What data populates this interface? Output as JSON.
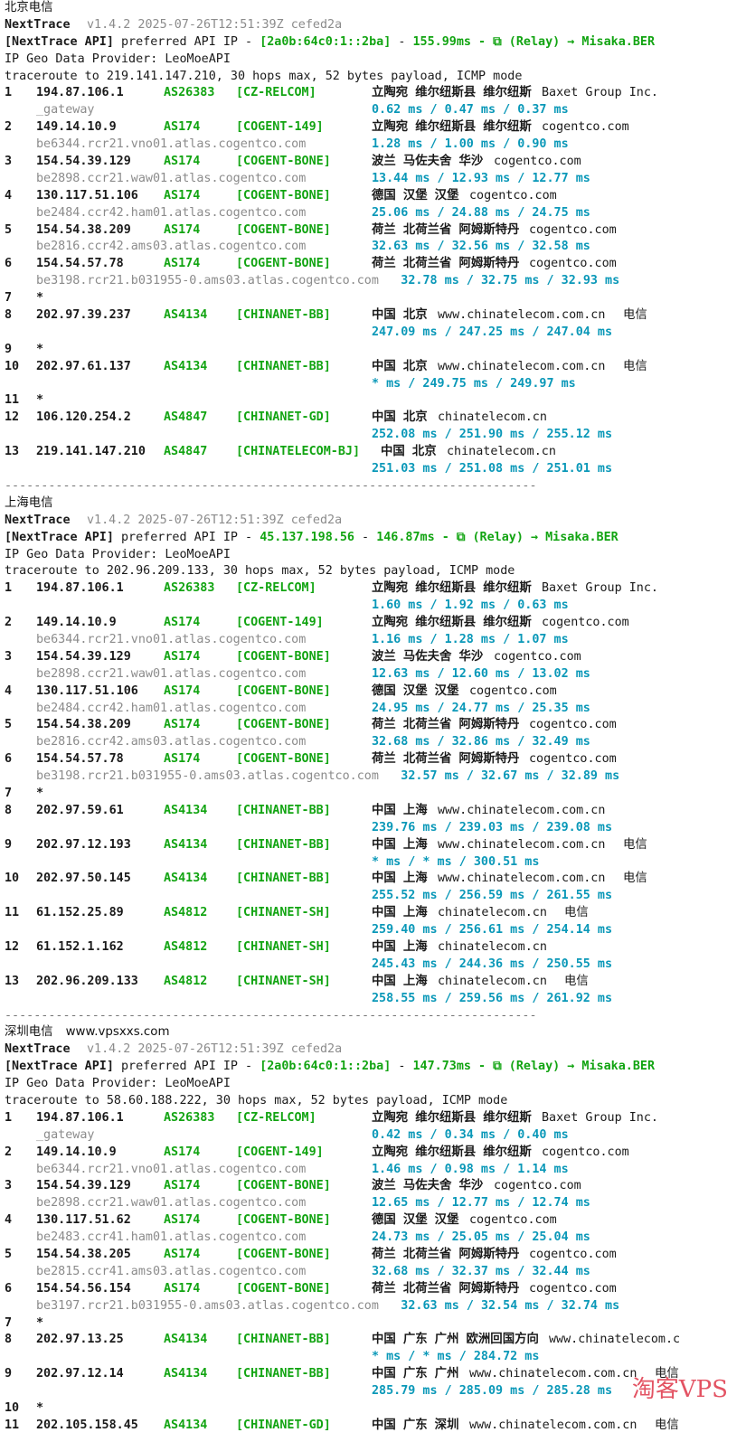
{
  "watermark": "淘客VPS",
  "sections": [
    {
      "name": "北京电信",
      "extra": "",
      "app": "NextTrace",
      "version": "v1.4.2 2025-07-26T12:51:39Z cefed2a",
      "api_prefix": "[NextTrace API]",
      "api_mid": " preferred API IP - ",
      "api_ip": "[2a0b:64c0:1::2ba]",
      "api_sep": " - ",
      "api_ms": "155.99ms",
      "api_tail": " - ⧉ (Relay) → Misaka.BER",
      "geo_provider": "IP Geo Data Provider: LeoMoeAPI",
      "traceroute": "traceroute to 219.141.147.210, 30 hops max, 52 bytes payload, ICMP mode",
      "hops": [
        {
          "n": "1",
          "ip": "194.87.106.1",
          "asn": "AS26383",
          "tag": "[CZ-RELCOM]",
          "geo": "立陶宛 维尔纽斯县 维尔纽斯",
          "dom": "Baxet Group Inc.",
          "rdns": "_gateway",
          "lat": "0.62 ms / 0.47 ms / 0.37 ms"
        },
        {
          "n": "2",
          "ip": "149.14.10.9",
          "asn": "AS174",
          "tag": "[COGENT-149]",
          "geo": "立陶宛 维尔纽斯县 维尔纽斯",
          "dom": "cogentco.com",
          "rdns": "be6344.rcr21.vno01.atlas.cogentco.com",
          "lat": "1.28 ms / 1.00 ms / 0.90 ms"
        },
        {
          "n": "3",
          "ip": "154.54.39.129",
          "asn": "AS174",
          "tag": "[COGENT-BONE]",
          "geo": "波兰 马佐夫舍 华沙",
          "dom": "cogentco.com",
          "rdns": "be2898.ccr21.waw01.atlas.cogentco.com",
          "lat": "13.44 ms / 12.93 ms / 12.77 ms"
        },
        {
          "n": "4",
          "ip": "130.117.51.106",
          "asn": "AS174",
          "tag": "[COGENT-BONE]",
          "geo": "德国 汉堡 汉堡",
          "dom": "cogentco.com",
          "rdns": "be2484.ccr42.ham01.atlas.cogentco.com",
          "lat": "25.06 ms / 24.88 ms / 24.75 ms"
        },
        {
          "n": "5",
          "ip": "154.54.38.209",
          "asn": "AS174",
          "tag": "[COGENT-BONE]",
          "geo": "荷兰 北荷兰省 阿姆斯特丹",
          "dom": "cogentco.com",
          "rdns": "be2816.ccr42.ams03.atlas.cogentco.com",
          "lat": "32.63 ms / 32.56 ms / 32.58 ms"
        },
        {
          "n": "6",
          "ip": "154.54.57.78",
          "asn": "AS174",
          "tag": "[COGENT-BONE]",
          "geo": "荷兰 北荷兰省 阿姆斯特丹",
          "dom": "cogentco.com",
          "rdns": "be3198.rcr21.b031955-0.ams03.atlas.cogentco.com",
          "lat": "32.78 ms / 32.75 ms / 32.93 ms",
          "inline": true
        },
        {
          "n": "7",
          "star": true
        },
        {
          "n": "8",
          "ip": "202.97.39.237",
          "asn": "AS4134",
          "tag": "[CHINANET-BB]",
          "geo": "中国 北京",
          "dom": "www.chinatelecom.com.cn",
          "isp": "电信",
          "lat": "247.09 ms / 247.25 ms / 247.04 ms"
        },
        {
          "n": "9",
          "star": true
        },
        {
          "n": "10",
          "ip": "202.97.61.137",
          "asn": "AS4134",
          "tag": "[CHINANET-BB]",
          "geo": "中国 北京",
          "dom": "www.chinatelecom.com.cn",
          "isp": "电信",
          "lat": "* ms / 249.75 ms / 249.97 ms"
        },
        {
          "n": "11",
          "star": true
        },
        {
          "n": "12",
          "ip": "106.120.254.2",
          "asn": "AS4847",
          "tag": "[CHINANET-GD]",
          "geo": "中国 北京",
          "dom": "chinatelecom.cn",
          "lat": "252.08 ms / 251.90 ms / 255.12 ms"
        },
        {
          "n": "13",
          "ip": "219.141.147.210",
          "asn": "AS4847",
          "tag": "[CHINATELECOM-BJ]",
          "geo": "中国 北京",
          "dom": "chinatelecom.cn",
          "lat": "251.03 ms / 251.08 ms / 251.01 ms",
          "geo_shift": true
        }
      ]
    },
    {
      "name": "上海电信",
      "extra": "",
      "app": "NextTrace",
      "version": "v1.4.2 2025-07-26T12:51:39Z cefed2a",
      "api_prefix": "[NextTrace API]",
      "api_mid": " preferred API IP - ",
      "api_ip": "45.137.198.56",
      "api_sep": " - ",
      "api_ms": "146.87ms",
      "api_tail": " - ⧉ (Relay) → Misaka.BER",
      "geo_provider": "IP Geo Data Provider: LeoMoeAPI",
      "traceroute": "traceroute to 202.96.209.133, 30 hops max, 52 bytes payload, ICMP mode",
      "hops": [
        {
          "n": "1",
          "ip": "194.87.106.1",
          "asn": "AS26383",
          "tag": "[CZ-RELCOM]",
          "geo": "立陶宛 维尔纽斯县 维尔纽斯",
          "dom": "Baxet Group Inc.",
          "rdns": "",
          "lat": "1.60 ms / 1.92 ms / 0.63 ms"
        },
        {
          "n": "2",
          "ip": "149.14.10.9",
          "asn": "AS174",
          "tag": "[COGENT-149]",
          "geo": "立陶宛 维尔纽斯县 维尔纽斯",
          "dom": "cogentco.com",
          "rdns": "be6344.rcr21.vno01.atlas.cogentco.com",
          "lat": "1.16 ms / 1.28 ms / 1.07 ms"
        },
        {
          "n": "3",
          "ip": "154.54.39.129",
          "asn": "AS174",
          "tag": "[COGENT-BONE]",
          "geo": "波兰 马佐夫舍 华沙",
          "dom": "cogentco.com",
          "rdns": "be2898.ccr21.waw01.atlas.cogentco.com",
          "lat": "12.63 ms / 12.60 ms / 13.02 ms"
        },
        {
          "n": "4",
          "ip": "130.117.51.106",
          "asn": "AS174",
          "tag": "[COGENT-BONE]",
          "geo": "德国 汉堡 汉堡",
          "dom": "cogentco.com",
          "rdns": "be2484.ccr42.ham01.atlas.cogentco.com",
          "lat": "24.95 ms / 24.77 ms / 25.35 ms"
        },
        {
          "n": "5",
          "ip": "154.54.38.209",
          "asn": "AS174",
          "tag": "[COGENT-BONE]",
          "geo": "荷兰 北荷兰省 阿姆斯特丹",
          "dom": "cogentco.com",
          "rdns": "be2816.ccr42.ams03.atlas.cogentco.com",
          "lat": "32.68 ms / 32.86 ms / 32.49 ms"
        },
        {
          "n": "6",
          "ip": "154.54.57.78",
          "asn": "AS174",
          "tag": "[COGENT-BONE]",
          "geo": "荷兰 北荷兰省 阿姆斯特丹",
          "dom": "cogentco.com",
          "rdns": "be3198.rcr21.b031955-0.ams03.atlas.cogentco.com",
          "lat": "32.57 ms / 32.67 ms / 32.89 ms",
          "inline": true
        },
        {
          "n": "7",
          "star": true
        },
        {
          "n": "8",
          "ip": "202.97.59.61",
          "asn": "AS4134",
          "tag": "[CHINANET-BB]",
          "geo": "中国 上海",
          "dom": "www.chinatelecom.com.cn",
          "lat": "239.76 ms / 239.03 ms / 239.08 ms"
        },
        {
          "n": "9",
          "ip": "202.97.12.193",
          "asn": "AS4134",
          "tag": "[CHINANET-BB]",
          "geo": "中国 上海",
          "dom": "www.chinatelecom.com.cn",
          "isp": "电信",
          "lat": "* ms / * ms / 300.51 ms"
        },
        {
          "n": "10",
          "ip": "202.97.50.145",
          "asn": "AS4134",
          "tag": "[CHINANET-BB]",
          "geo": "中国 上海",
          "dom": "www.chinatelecom.com.cn",
          "isp": "电信",
          "lat": "255.52 ms / 256.59 ms / 261.55 ms"
        },
        {
          "n": "11",
          "ip": "61.152.25.89",
          "asn": "AS4812",
          "tag": "[CHINANET-SH]",
          "geo": "中国 上海",
          "dom": "chinatelecom.cn",
          "isp": "电信",
          "lat": "259.40 ms / 256.61 ms / 254.14 ms"
        },
        {
          "n": "12",
          "ip": "61.152.1.162",
          "asn": "AS4812",
          "tag": "[CHINANET-SH]",
          "geo": "中国 上海",
          "dom": "chinatelecom.cn",
          "lat": "245.43 ms / 244.36 ms / 250.55 ms"
        },
        {
          "n": "13",
          "ip": "202.96.209.133",
          "asn": "AS4812",
          "tag": "[CHINANET-SH]",
          "geo": "中国 上海",
          "dom": "chinatelecom.cn",
          "isp": "电信",
          "lat": "258.55 ms / 259.56 ms / 261.92 ms"
        }
      ]
    },
    {
      "name": "深圳电信",
      "extra": "www.vpsxxs.com",
      "app": "NextTrace",
      "version": "v1.4.2 2025-07-26T12:51:39Z cefed2a",
      "api_prefix": "[NextTrace API]",
      "api_mid": " preferred API IP - ",
      "api_ip": "[2a0b:64c0:1::2ba]",
      "api_sep": " - ",
      "api_ms": "147.73ms",
      "api_tail": " - ⧉ (Relay) → Misaka.BER",
      "geo_provider": "IP Geo Data Provider: LeoMoeAPI",
      "traceroute": "traceroute to 58.60.188.222, 30 hops max, 52 bytes payload, ICMP mode",
      "hops": [
        {
          "n": "1",
          "ip": "194.87.106.1",
          "asn": "AS26383",
          "tag": "[CZ-RELCOM]",
          "geo": "立陶宛 维尔纽斯县 维尔纽斯",
          "dom": "Baxet Group Inc.",
          "rdns": "_gateway",
          "lat": "0.42 ms / 0.34 ms / 0.40 ms"
        },
        {
          "n": "2",
          "ip": "149.14.10.9",
          "asn": "AS174",
          "tag": "[COGENT-149]",
          "geo": "立陶宛 维尔纽斯县 维尔纽斯",
          "dom": "cogentco.com",
          "rdns": "be6344.rcr21.vno01.atlas.cogentco.com",
          "lat": "1.46 ms / 0.98 ms / 1.14 ms"
        },
        {
          "n": "3",
          "ip": "154.54.39.129",
          "asn": "AS174",
          "tag": "[COGENT-BONE]",
          "geo": "波兰 马佐夫舍 华沙",
          "dom": "cogentco.com",
          "rdns": "be2898.ccr21.waw01.atlas.cogentco.com",
          "lat": "12.65 ms / 12.77 ms / 12.74 ms"
        },
        {
          "n": "4",
          "ip": "130.117.51.62",
          "asn": "AS174",
          "tag": "[COGENT-BONE]",
          "geo": "德国 汉堡 汉堡",
          "dom": "cogentco.com",
          "rdns": "be2483.ccr41.ham01.atlas.cogentco.com",
          "lat": "24.73 ms / 25.05 ms / 25.04 ms"
        },
        {
          "n": "5",
          "ip": "154.54.38.205",
          "asn": "AS174",
          "tag": "[COGENT-BONE]",
          "geo": "荷兰 北荷兰省 阿姆斯特丹",
          "dom": "cogentco.com",
          "rdns": "be2815.ccr41.ams03.atlas.cogentco.com",
          "lat": "32.68 ms / 32.37 ms / 32.44 ms"
        },
        {
          "n": "6",
          "ip": "154.54.56.154",
          "asn": "AS174",
          "tag": "[COGENT-BONE]",
          "geo": "荷兰 北荷兰省 阿姆斯特丹",
          "dom": "cogentco.com",
          "rdns": "be3197.rcr21.b031955-0.ams03.atlas.cogentco.com",
          "lat": "32.63 ms / 32.54 ms / 32.74 ms",
          "inline": true
        },
        {
          "n": "7",
          "star": true
        },
        {
          "n": "8",
          "ip": "202.97.13.25",
          "asn": "AS4134",
          "tag": "[CHINANET-BB]",
          "geo": "中国 广东 广州 欧洲回国方向",
          "dom": "www.chinatelecom.c",
          "lat": "* ms / * ms / 284.72 ms"
        },
        {
          "n": "9",
          "ip": "202.97.12.14",
          "asn": "AS4134",
          "tag": "[CHINANET-BB]",
          "geo": "中国 广东 广州",
          "dom": "www.chinatelecom.com.cn",
          "isp": "电信",
          "lat": "285.79 ms / 285.09 ms / 285.28 ms"
        },
        {
          "n": "10",
          "star": true
        },
        {
          "n": "11",
          "ip": "202.105.158.45",
          "asn": "AS4134",
          "tag": "[CHINANET-GD]",
          "geo": "中国 广东 深圳",
          "dom": "www.chinatelecom.com.cn",
          "isp": "电信",
          "lat": ""
        }
      ]
    }
  ],
  "separator": "-------------------------------------------------------------------------"
}
